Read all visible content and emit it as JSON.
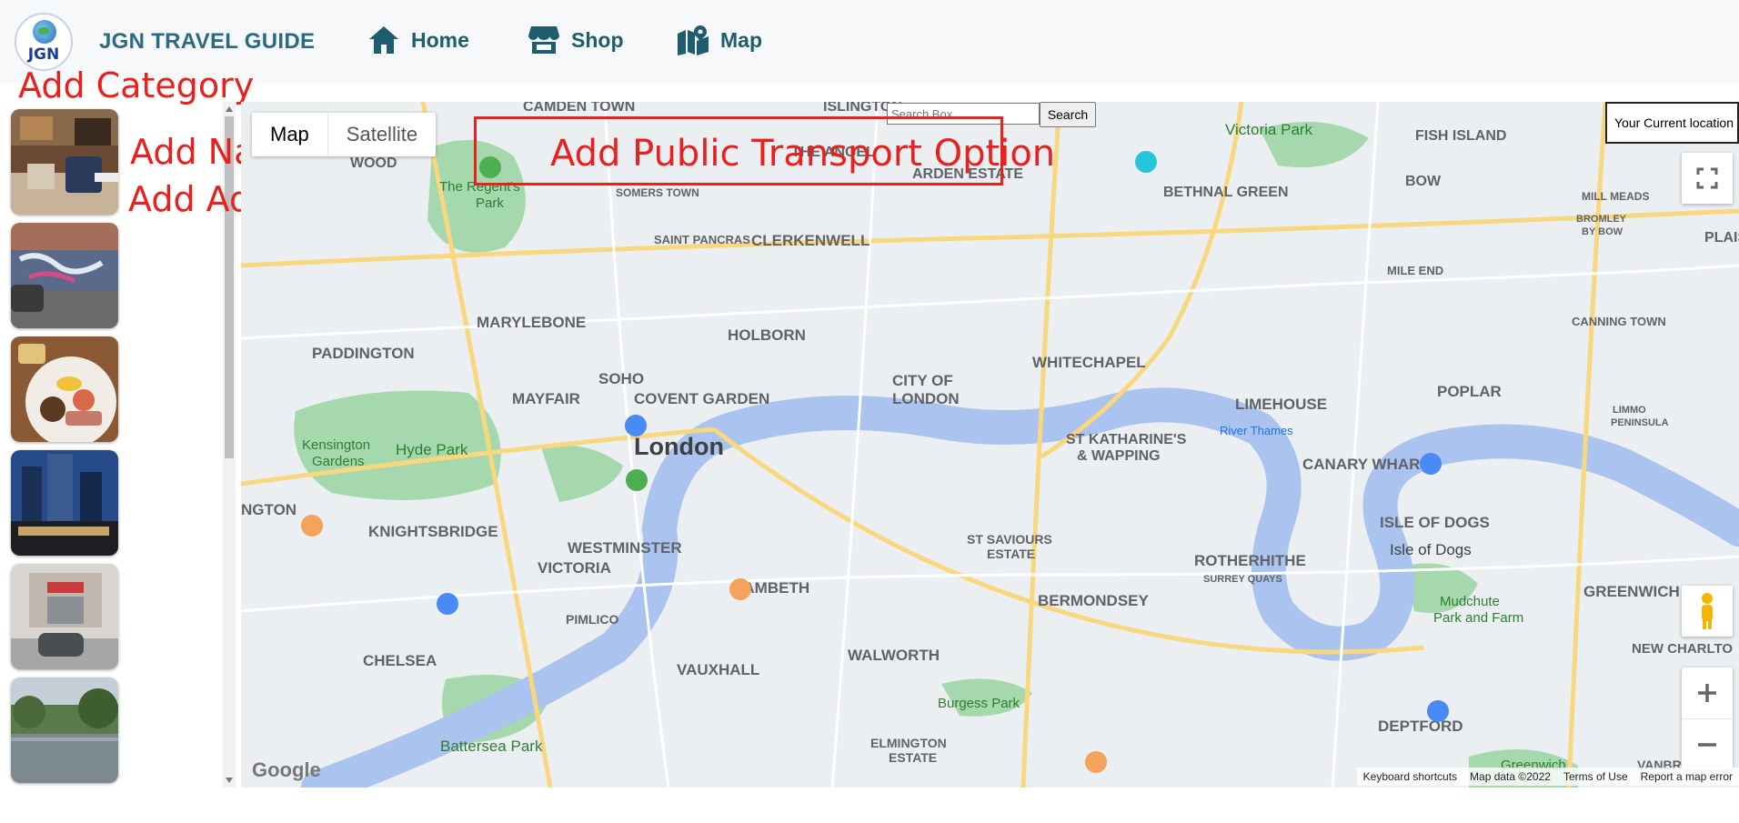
{
  "header": {
    "logo_text": "JGN",
    "brand": "JGN TRAVEL GUIDE",
    "nav": [
      {
        "label": "Home",
        "icon": "home-icon"
      },
      {
        "label": "Shop",
        "icon": "shop-icon"
      },
      {
        "label": "Map",
        "icon": "map-icon"
      }
    ]
  },
  "sidebar": {
    "add_category": "Add Category",
    "card_name": "Add Name",
    "card_address": "Add Addrese",
    "thumbnails": [
      {
        "name": "restaurant-interior-photo"
      },
      {
        "name": "graffiti-street-photo"
      },
      {
        "name": "english-breakfast-photo"
      },
      {
        "name": "skyscraper-night-photo"
      },
      {
        "name": "shopfront-street-photo"
      },
      {
        "name": "lake-park-photo"
      }
    ]
  },
  "map": {
    "type_controls": {
      "map": "Map",
      "satellite": "Satellite"
    },
    "search": {
      "placeholder": "Search Box",
      "button": "Search"
    },
    "transport_annotation": "Add Public Transport Option",
    "current_location": "Your Current location",
    "google_logo": "Google",
    "footer": {
      "shortcuts": "Keyboard shortcuts",
      "map_data": "Map data ©2022",
      "terms": "Terms of Use",
      "report": "Report a map error"
    },
    "district_labels": [
      "CAMDEN TOWN",
      "ISLINGTON",
      "WOOD",
      "The Regent's Park",
      "SOMERS TOWN",
      "THE ANGEL",
      "ARDEN ESTATE",
      "Victoria Park",
      "FISH ISLAND",
      "BOW",
      "BETHNAL GREEN",
      "MILL MEADS",
      "BROMLEY BY BOW",
      "PLAIS",
      "SAINT PANCRAS",
      "CLERKENWELL",
      "MILE END",
      "CANNING TOWN",
      "MARYLEBONE",
      "HOLBORN",
      "PADDINGTON",
      "WHITECHAPEL",
      "SOHO",
      "CITY OF LONDON",
      "LIMEHOUSE",
      "POPLAR",
      "MAYFAIR",
      "COVENT GARDEN",
      "London",
      "Kensington Gardens",
      "Hyde Park",
      "ST KATHARINE'S & WAPPING",
      "CANARY WHARF",
      "River Thames",
      "NGTON",
      "KNIGHTSBRIDGE",
      "WESTMINSTER",
      "VICTORIA",
      "ST SAVIOURS ESTATE",
      "ISLE OF DOGS",
      "Isle of Dogs",
      "ROTHERHITHE",
      "SURREY QUAYS",
      "LAMBETH",
      "BERMONDSEY",
      "PIMLICO",
      "Mudchute Park and Farm",
      "GREENWICH",
      "CHELSEA",
      "WALWORTH",
      "NEW CHARLTO",
      "VAUXHALL",
      "Burgess Park",
      "DEPTFORD",
      "ELMINGTON ESTATE",
      "Battersea Park",
      "Greenwich",
      "VANBRUGH",
      "LIMMO PENINSULA"
    ]
  },
  "colors": {
    "brand": "#2a6b83",
    "annotation_red": "#e8201e",
    "river": "#aac4ef",
    "park": "#9fd5a7",
    "map_bg": "#eceff1"
  }
}
